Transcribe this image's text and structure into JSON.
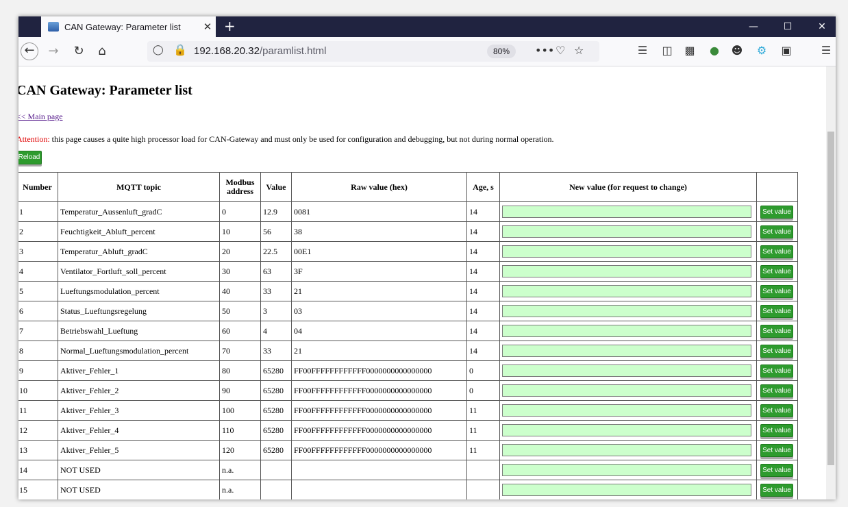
{
  "browser": {
    "tab_title": "CAN Gateway: Parameter list",
    "tab_close": "✕",
    "new_tab": "+",
    "url_host": "192.168.20.32",
    "url_path": "/paramlist.html",
    "zoom": "80%",
    "more_actions": "•••"
  },
  "page": {
    "title": "CAN Gateway: Parameter list",
    "main_link": "<< Main page",
    "attention_label": "Attention:",
    "attention_text": " this page causes a quite high processor load for CAN-Gateway and must only be used for configuration and debugging, but not during normal operation.",
    "reload_label": "Reload",
    "set_value_label": "Set value"
  },
  "table": {
    "headers": {
      "number": "Number",
      "topic": "MQTT topic",
      "modbus1": "Modbus",
      "modbus2": "address",
      "value": "Value",
      "raw": "Raw value (hex)",
      "age": "Age, s",
      "newval": "New value (for request to change)"
    },
    "rows": [
      {
        "number": "1",
        "topic": "Temperatur_Aussenluft_gradC",
        "modbus": "0",
        "value": "12.9",
        "raw": "0081",
        "age": "14"
      },
      {
        "number": "2",
        "topic": "Feuchtigkeit_Abluft_percent",
        "modbus": "10",
        "value": "56",
        "raw": "38",
        "age": "14"
      },
      {
        "number": "3",
        "topic": "Temperatur_Abluft_gradC",
        "modbus": "20",
        "value": "22.5",
        "raw": "00E1",
        "age": "14"
      },
      {
        "number": "4",
        "topic": "Ventilator_Fortluft_soll_percent",
        "modbus": "30",
        "value": "63",
        "raw": "3F",
        "age": "14"
      },
      {
        "number": "5",
        "topic": "Lueftungsmodulation_percent",
        "modbus": "40",
        "value": "33",
        "raw": "21",
        "age": "14"
      },
      {
        "number": "6",
        "topic": "Status_Lueftungsregelung",
        "modbus": "50",
        "value": "3",
        "raw": "03",
        "age": "14"
      },
      {
        "number": "7",
        "topic": "Betriebswahl_Lueftung",
        "modbus": "60",
        "value": "4",
        "raw": "04",
        "age": "14"
      },
      {
        "number": "8",
        "topic": "Normal_Lueftungsmodulation_percent",
        "modbus": "70",
        "value": "33",
        "raw": "21",
        "age": "14"
      },
      {
        "number": "9",
        "topic": "Aktiver_Fehler_1",
        "modbus": "80",
        "value": "65280",
        "raw": "FF00FFFFFFFFFFFF0000000000000000",
        "age": "0"
      },
      {
        "number": "10",
        "topic": "Aktiver_Fehler_2",
        "modbus": "90",
        "value": "65280",
        "raw": "FF00FFFFFFFFFFFF0000000000000000",
        "age": "0"
      },
      {
        "number": "11",
        "topic": "Aktiver_Fehler_3",
        "modbus": "100",
        "value": "65280",
        "raw": "FF00FFFFFFFFFFFF0000000000000000",
        "age": "11"
      },
      {
        "number": "12",
        "topic": "Aktiver_Fehler_4",
        "modbus": "110",
        "value": "65280",
        "raw": "FF00FFFFFFFFFFFF0000000000000000",
        "age": "11"
      },
      {
        "number": "13",
        "topic": "Aktiver_Fehler_5",
        "modbus": "120",
        "value": "65280",
        "raw": "FF00FFFFFFFFFFFF0000000000000000",
        "age": "11"
      },
      {
        "number": "14",
        "topic": "NOT USED",
        "modbus": "n.a.",
        "value": "",
        "raw": "",
        "age": ""
      },
      {
        "number": "15",
        "topic": "NOT USED",
        "modbus": "n.a.",
        "value": "",
        "raw": "",
        "age": ""
      }
    ]
  }
}
